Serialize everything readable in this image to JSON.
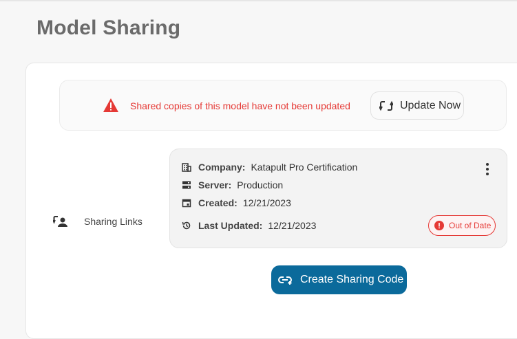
{
  "page": {
    "title": "Model Sharing"
  },
  "alert": {
    "message": "Shared copies of this model have not been updated",
    "update_label": "Update Now",
    "icon": "warning-icon",
    "color": "#e53935"
  },
  "sharing": {
    "label": "Sharing Links",
    "icon": "sharing-links-icon"
  },
  "card": {
    "company_key": "Company:",
    "company_value": "Katapult Pro Certification",
    "server_key": "Server:",
    "server_value": "Production",
    "created_key": "Created:",
    "created_value": "12/21/2023",
    "updated_key": "Last Updated:",
    "updated_value": "12/21/2023",
    "status_label": "Out of Date",
    "status_color": "#e53935"
  },
  "create_button": {
    "label": "Create Sharing Code",
    "color": "#0b6a9b"
  }
}
